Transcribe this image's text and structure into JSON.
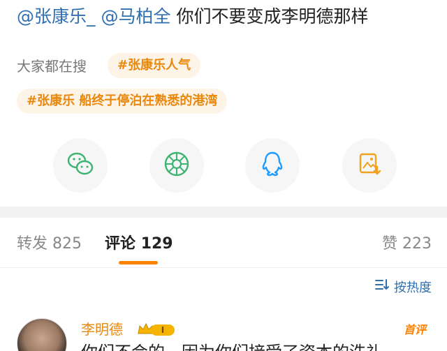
{
  "post": {
    "mention1": "@张康乐_",
    "mention2": "@马柏全",
    "text": "你们不要变成李明德那样"
  },
  "hot_search": {
    "label": "大家都在搜",
    "tags": [
      "#张康乐人气",
      "#张康乐 船终于停泊在熟悉的港湾"
    ]
  },
  "share": {
    "icons": [
      "wechat-icon",
      "moments-icon",
      "qq-icon",
      "save-image-icon"
    ],
    "colors": {
      "wechat": "#3cb371",
      "moments": "#3cb371",
      "qq": "#1e9bff",
      "save": "#f0a11e"
    }
  },
  "tabs": {
    "repost_label": "转发",
    "repost_count": "825",
    "comment_label": "评论",
    "comment_count": "129",
    "like_label": "赞",
    "like_count": "223"
  },
  "sort": {
    "label": "按热度"
  },
  "comment": {
    "author": "李明德",
    "badge_text": "I",
    "tag": "首评",
    "text": "你们不会的，因为你们接受了资本的洗礼"
  },
  "colors": {
    "accent": "#ff8200",
    "link": "#2f6fb0",
    "tag_bg": "#fdf3e6",
    "tag_text": "#e8880c"
  }
}
